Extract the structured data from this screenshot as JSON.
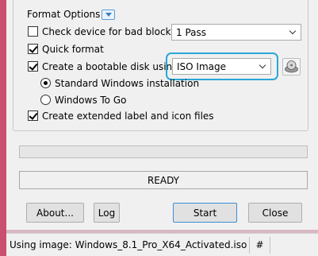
{
  "format_options": {
    "title": "Format Options",
    "check_bad_blocks": {
      "label": "Check device for bad blocks",
      "checked": false,
      "passes": "1 Pass"
    },
    "quick_format": {
      "label": "Quick format",
      "checked": true
    },
    "bootable_disk": {
      "label": "Create a bootable disk using",
      "checked": true,
      "source": "ISO Image"
    },
    "standard_windows": {
      "label": "Standard Windows installation",
      "selected": true
    },
    "windows_to_go": {
      "label": "Windows To Go",
      "selected": false
    },
    "extended_label": {
      "label": "Create extended label and icon files",
      "checked": true
    }
  },
  "progress": {
    "value": 0
  },
  "status": {
    "text": "READY"
  },
  "buttons": {
    "about": "About...",
    "log": "Log",
    "start": "Start",
    "close": "Close"
  },
  "statusbar": {
    "message": "Using image: Windows_8.1_Pro_X64_Activated.iso",
    "hash": "#"
  },
  "colors": {
    "accent": "#2aa7d8",
    "window_border": "#c9506e",
    "background": "#f0f0f0"
  }
}
